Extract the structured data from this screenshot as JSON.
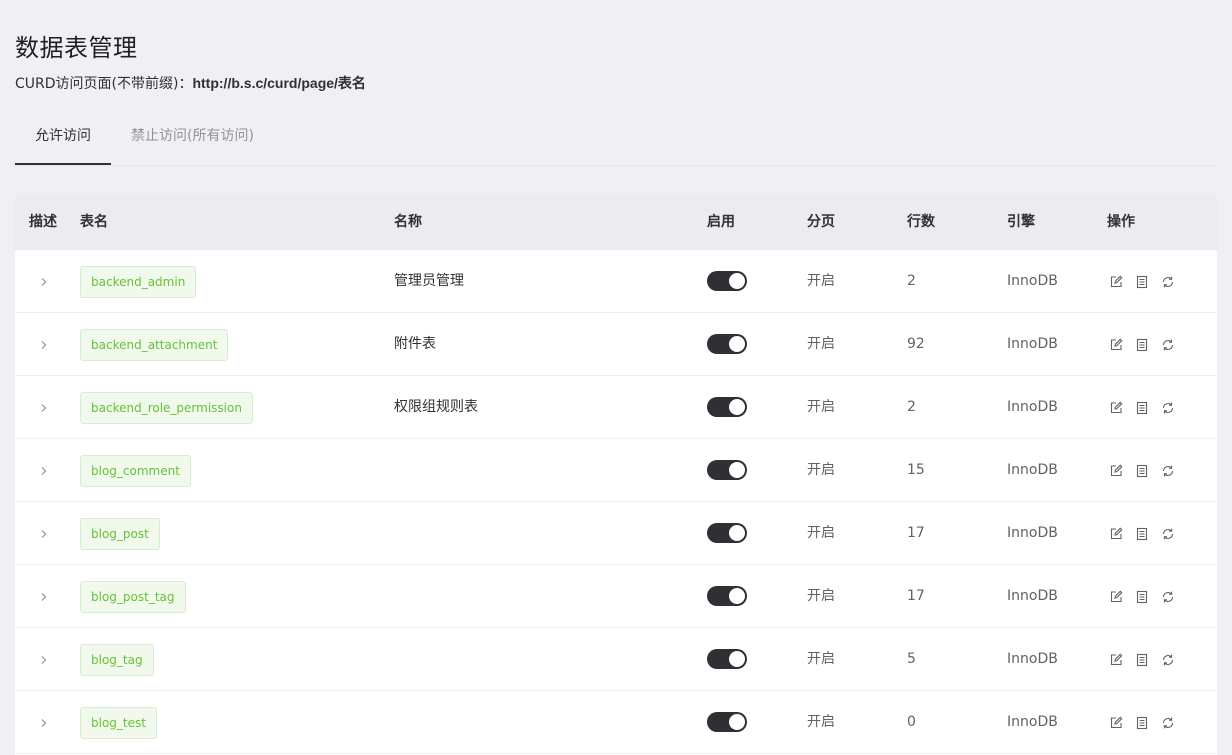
{
  "header": {
    "title": "数据表管理",
    "curd_label": "CURD访问页面(不带前缀)：",
    "curd_url": "http://b.s.c/curd/page/表名"
  },
  "tabs": [
    {
      "label": "允许访问",
      "active": true
    },
    {
      "label": "禁止访问(所有访问)",
      "active": false
    }
  ],
  "table": {
    "headers": {
      "desc": "描述",
      "table_name": "表名",
      "name": "名称",
      "enabled": "启用",
      "paging": "分页",
      "rows": "行数",
      "engine": "引擎",
      "actions": "操作"
    },
    "rows": [
      {
        "table": "backend_admin",
        "name": "管理员管理",
        "enabled": true,
        "paging": "开启",
        "rows": "2",
        "engine": "InnoDB"
      },
      {
        "table": "backend_attachment",
        "name": "附件表",
        "enabled": true,
        "paging": "开启",
        "rows": "92",
        "engine": "InnoDB"
      },
      {
        "table": "backend_role_permission",
        "name": "权限组规则表",
        "enabled": true,
        "paging": "开启",
        "rows": "2",
        "engine": "InnoDB"
      },
      {
        "table": "blog_comment",
        "name": "",
        "enabled": true,
        "paging": "开启",
        "rows": "15",
        "engine": "InnoDB"
      },
      {
        "table": "blog_post",
        "name": "",
        "enabled": true,
        "paging": "开启",
        "rows": "17",
        "engine": "InnoDB"
      },
      {
        "table": "blog_post_tag",
        "name": "",
        "enabled": true,
        "paging": "开启",
        "rows": "17",
        "engine": "InnoDB"
      },
      {
        "table": "blog_tag",
        "name": "",
        "enabled": true,
        "paging": "开启",
        "rows": "5",
        "engine": "InnoDB"
      },
      {
        "table": "blog_test",
        "name": "",
        "enabled": true,
        "paging": "开启",
        "rows": "0",
        "engine": "InnoDB"
      }
    ],
    "action_icons": [
      "edit-icon",
      "document-icon",
      "refresh-icon"
    ]
  },
  "colors": {
    "tag_text": "#67c23a",
    "tag_bg": "#f0f9eb",
    "switch_on": "#2f3033",
    "page_bg": "#f0f0f4"
  }
}
